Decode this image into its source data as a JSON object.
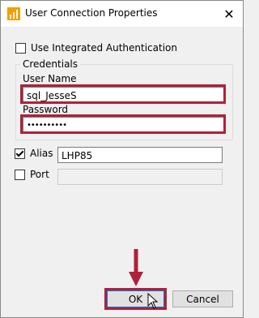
{
  "window": {
    "title": "User Connection Properties",
    "close_glyph": "✕"
  },
  "integrated_auth": {
    "label": "Use Integrated Authentication",
    "checked": false
  },
  "credentials": {
    "group_label": "Credentials",
    "username_label": "User Name",
    "username_value": "sql_JesseS",
    "password_label": "Password",
    "password_value": "••••••••••"
  },
  "alias": {
    "label": "Alias",
    "checked": true,
    "value": "LHP85"
  },
  "port": {
    "label": "Port",
    "checked": false,
    "value": ""
  },
  "buttons": {
    "ok_label": "OK",
    "cancel_label": "Cancel"
  },
  "colors": {
    "highlight": "#b0203a",
    "title_icon": "#f2a000"
  },
  "icons": {
    "app": "bar-chart-icon",
    "close": "close-icon",
    "annotation_arrow": "down-arrow-icon",
    "cursor": "mouse-pointer-icon"
  }
}
